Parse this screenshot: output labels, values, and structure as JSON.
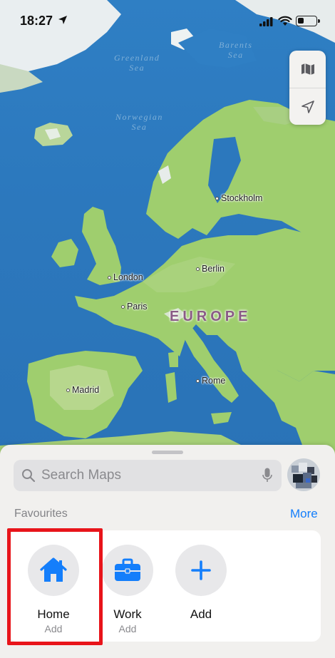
{
  "status_bar": {
    "time": "18:27"
  },
  "map": {
    "sea_labels": [
      {
        "name": "Greenland",
        "sub": "Sea"
      },
      {
        "name": "Barents",
        "sub": "Sea"
      },
      {
        "name": "Norwegian",
        "sub": "Sea"
      }
    ],
    "cities": [
      "Stockholm",
      "Berlin",
      "London",
      "Paris",
      "Madrid",
      "Rome"
    ],
    "region_label": "EUROPE",
    "controls": [
      {
        "icon": "map-icon"
      },
      {
        "icon": "location-arrow-icon"
      }
    ]
  },
  "sheet": {
    "search_placeholder": "Search Maps",
    "favourites_title": "Favourites",
    "more_label": "More",
    "favourites": [
      {
        "label": "Home",
        "sub": "Add",
        "icon": "house-icon"
      },
      {
        "label": "Work",
        "sub": "Add",
        "icon": "briefcase-icon"
      },
      {
        "label": "Add",
        "sub": "",
        "icon": "plus-icon"
      }
    ]
  },
  "colors": {
    "accent": "#147efb",
    "highlight": "#e8141a",
    "land": "#9fce6e",
    "sea": "#2c78bd"
  }
}
